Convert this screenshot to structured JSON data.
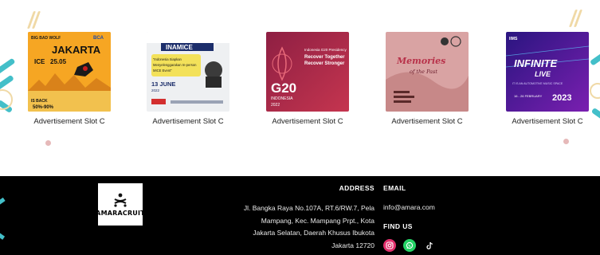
{
  "colors": {
    "footer_bg": "#000000",
    "accent_teal": "#43bfc9",
    "accent_cream": "#f0d9a6",
    "instagram": "#e1306c",
    "whatsapp": "#25d366"
  },
  "ads": [
    {
      "caption": "Advertisement Slot C",
      "poster": {
        "title": "JAKARTA",
        "top_left": "BIG BAD WOLF",
        "top_right": "BCA",
        "mid": "ICE",
        "date": "25.05",
        "discount": "50%-90%",
        "badge": "IS BACK",
        "bg": "#f6a623"
      }
    },
    {
      "caption": "Advertisement Slot C",
      "poster": {
        "title": "INAMICE",
        "quote": "Indonesia Siapkan Menyelenggarakan In-person MICE Event",
        "date": "13 JUNE",
        "year": "2022",
        "bg": "#eef0f2"
      }
    },
    {
      "caption": "Advertisement Slot C",
      "poster": {
        "title": "G20",
        "sub": "INDONESIA",
        "year": "2022",
        "l1": "Indonesia G20 Presidency",
        "l2": "Recover Together",
        "l3": "Recover Stronger",
        "bg": "#a12a4a"
      }
    },
    {
      "caption": "Advertisement Slot C",
      "poster": {
        "title": "Memories",
        "sub": "of the Past",
        "bg": "#d9a3a3"
      }
    },
    {
      "caption": "Advertisement Slot C",
      "poster": {
        "title": "INFINITE",
        "sub": "LIVE",
        "tag": "IT IS AN AUTOMOTIVE MUSIC SPACE",
        "year": "2023",
        "date": "16 - 26 FEBRUARY",
        "top": "IIMS",
        "bg": "#3b1a8a"
      }
    }
  ],
  "footer": {
    "brand": "AMARACRUIT",
    "address_title": "ADDRESS",
    "address_lines": [
      "Jl. Bangka Raya No.107A, RT.6/RW.7, Pela",
      "Mampang, Kec. Mampang Prpt., Kota",
      "Jakarta Selatan, Daerah Khusus Ibukota",
      "Jakarta 12720"
    ],
    "email_title": "EMAIL",
    "email": "info@amara.com",
    "find_title": "FIND US",
    "socials": [
      {
        "name": "instagram-icon"
      },
      {
        "name": "whatsapp-icon"
      },
      {
        "name": "tiktok-icon"
      }
    ]
  }
}
